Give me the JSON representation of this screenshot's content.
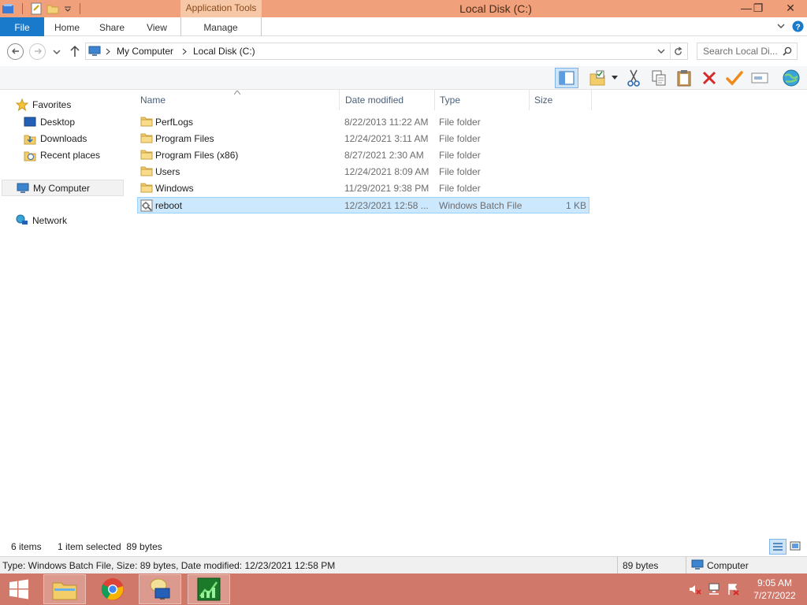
{
  "window": {
    "title": "Local Disk (C:)",
    "context_tab_group": "Application Tools",
    "minimize_glyph": "—",
    "restore_glyph": "❐",
    "close_glyph": "✕"
  },
  "ribbon": {
    "tabs": [
      {
        "label": "File"
      },
      {
        "label": "Home"
      },
      {
        "label": "Share"
      },
      {
        "label": "View"
      },
      {
        "label": "Manage"
      }
    ]
  },
  "address": {
    "crumbs": [
      "My Computer",
      "Local Disk (C:)"
    ]
  },
  "search": {
    "placeholder": "Search Local Di..."
  },
  "nav": {
    "favorites": "Favorites",
    "items": [
      {
        "label": "Desktop",
        "icon": "desktop-icon"
      },
      {
        "label": "Downloads",
        "icon": "downloads-icon"
      },
      {
        "label": "Recent places",
        "icon": "recent-places-icon"
      }
    ],
    "computer": "My Computer",
    "network": "Network"
  },
  "columns": {
    "name": "Name",
    "date": "Date modified",
    "type": "Type",
    "size": "Size"
  },
  "files": [
    {
      "name": "PerfLogs",
      "date": "8/22/2013 11:22 AM",
      "type": "File folder",
      "size": "",
      "icon": "folder-icon",
      "selected": false
    },
    {
      "name": "Program Files",
      "date": "12/24/2021 3:11 AM",
      "type": "File folder",
      "size": "",
      "icon": "folder-icon",
      "selected": false
    },
    {
      "name": "Program Files (x86)",
      "date": "8/27/2021 2:30 AM",
      "type": "File folder",
      "size": "",
      "icon": "folder-icon",
      "selected": false
    },
    {
      "name": "Users",
      "date": "12/24/2021 8:09 AM",
      "type": "File folder",
      "size": "",
      "icon": "folder-icon",
      "selected": false
    },
    {
      "name": "Windows",
      "date": "11/29/2021 9:38 PM",
      "type": "File folder",
      "size": "",
      "icon": "folder-icon",
      "selected": false
    },
    {
      "name": "reboot",
      "date": "12/23/2021 12:58 ...",
      "type": "Windows Batch File",
      "size": "1 KB",
      "icon": "batch-file-icon",
      "selected": true
    }
  ],
  "status": {
    "item_count": "6 items",
    "selection": "1 item selected  89 bytes",
    "details": "Type: Windows Batch File, Size: 89 bytes, Date modified: 12/23/2021 12:58 PM",
    "size": "89 bytes",
    "location": "Computer"
  },
  "taskbar": {
    "time": "9:05 AM",
    "date": "7/27/2022"
  },
  "colors": {
    "titlebar": "#f0a07a",
    "taskbar": "#d0786a",
    "file_tab": "#1979ca",
    "selection": "#cce8ff"
  }
}
